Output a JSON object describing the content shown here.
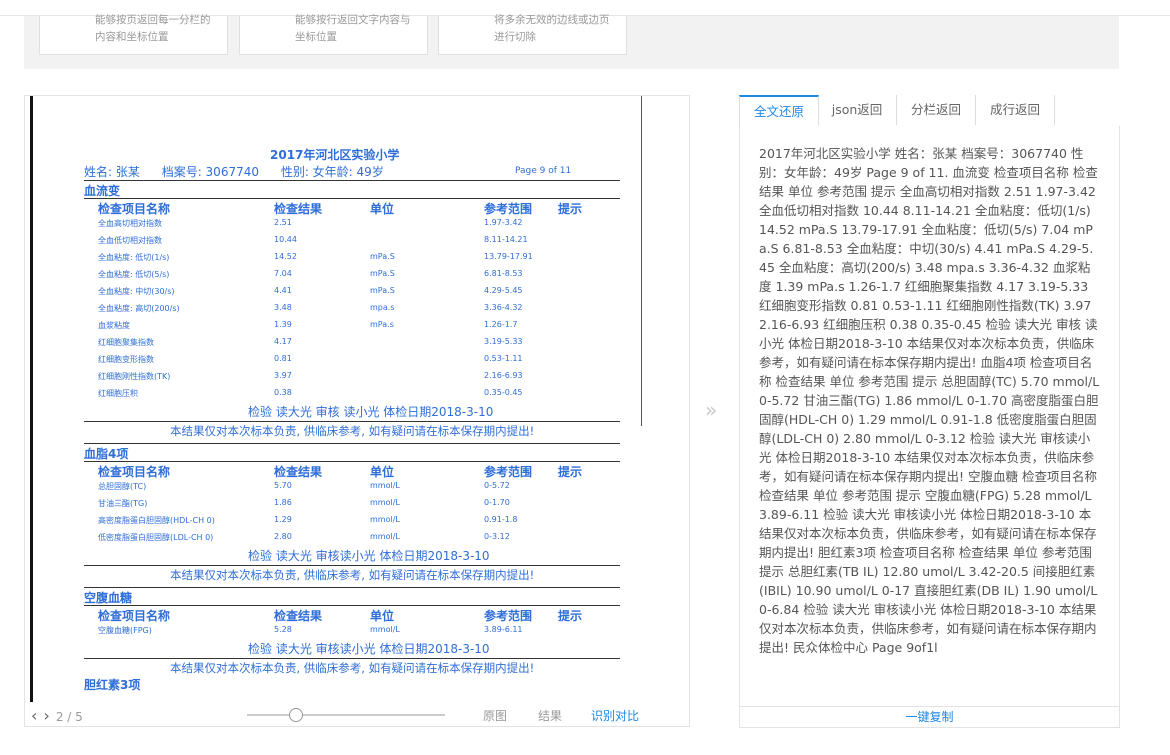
{
  "features": [
    {
      "desc": "能够按页返回每一分栏的\n内容和坐标位置"
    },
    {
      "desc": "能够按行返回文字内容与\n坐标位置"
    },
    {
      "desc": "将多余无效的边线或边页\n进行切除"
    }
  ],
  "doc": {
    "title": "2017年河北区实验小学",
    "name": "姓名: 张某",
    "file_no": "档案号: 3067740",
    "gender": "性别: 女年龄: 49岁",
    "page": "Page 9 of 11",
    "sections": [
      {
        "name": "血流变",
        "headers": [
          "检查项目名称",
          "检查结果",
          "单位",
          "参考范围",
          "提示"
        ],
        "rows": [
          [
            "全血高切相对指数",
            "2.51",
            "",
            "1.97-3.42"
          ],
          [
            "全血低切相对指数",
            "10.44",
            "",
            "8.11-14.21"
          ],
          [
            "全血粘度: 低切(1/s)",
            "14.52",
            "mPa.S",
            "13.79-17.91"
          ],
          [
            "全血粘度: 低切(5/s)",
            "7.04",
            "mPa.S",
            "6.81-8.53"
          ],
          [
            "全血粘度: 中切(30/s)",
            "4.41",
            "mPa.S",
            "4.29-5.45"
          ],
          [
            "全血粘度: 高切(200/s)",
            "3.48",
            "mpa.s",
            "3.36-4.32"
          ],
          [
            "血浆粘度",
            "1.39",
            "mPa.s",
            "1.26-1.7"
          ],
          [
            "红细胞聚集指数",
            "4.17",
            "",
            "3.19-5.33"
          ],
          [
            "红细胞变形指数",
            "0.81",
            "",
            "0.53-1.11"
          ],
          [
            "红细胞刚性指数(TK)",
            "3.97",
            "",
            "2.16-6.93"
          ],
          [
            "红细胞压积",
            "0.38",
            "",
            "0.35-0.45"
          ]
        ],
        "sign": "检验  读大光    审核  读小光    体检日期2018-3-10",
        "note": "本结果仅对本次标本负责, 供临床参考, 如有疑问请在标本保存期内提出!"
      },
      {
        "name": "血脂4项",
        "headers": [
          "检查项目名称",
          "检查结果",
          "单位",
          "参考范围",
          "提示"
        ],
        "rows": [
          [
            "总胆固醇(TC)",
            "5.70",
            "mmol/L",
            "0-5.72"
          ],
          [
            "甘油三酯(TG)",
            "1.86",
            "mmol/L",
            "0-1.70"
          ],
          [
            "高密度脂蛋白胆固醇(HDL-CH 0)",
            "1.29",
            "mmol/L",
            "0.91-1.8"
          ],
          [
            "低密度脂蛋白胆固醇(LDL-CH 0)",
            "2.80",
            "mmol/L",
            "0-3.12"
          ]
        ],
        "sign": "检验  读大光    审核读小光    体检日期2018-3-10",
        "note": "本结果仅对本次标本负责, 供临床参考, 如有疑问请在标本保存期内提出!"
      },
      {
        "name": "空腹血糖",
        "headers": [
          "检查项目名称",
          "检查结果",
          "单位",
          "参考范围",
          "提示"
        ],
        "rows": [
          [
            "空腹血糖(FPG)",
            "5.28",
            "mmol/L",
            "3.89-6.11"
          ]
        ],
        "sign": "检验  读大光    审核读小光    体检日期2018-3-10",
        "note": "本结果仅对本次标本负责, 供临床参考, 如有疑问请在标本保存期内提出!"
      }
    ],
    "next_section": "胆红素3项"
  },
  "viewer": {
    "page_indicator": "2 / 5",
    "btn_original": "原图",
    "btn_result": "结果",
    "btn_compare": "识别对比"
  },
  "tabs": [
    "全文还原",
    "json返回",
    "分栏返回",
    "成行返回"
  ],
  "result_text": "2017年河北区实验小学 姓名：张某 档案号：3067740 性别：女年龄：49岁 Page 9 of 11. 血流变 检查项目名称 检查结果 单位 参考范围 提示 全血高切相对指数 2.51 1.97-3.42 全血低切相对指数 10.44 8.11-14.21 全血粘度：低切(1/s) 14.52 mPa.S 13.79-17.91 全血粘度：低切(5/s) 7.04 mPa.S 6.81-8.53 全血粘度：中切(30/s) 4.41 mPa.S 4.29-5.45 全血粘度：高切(200/s) 3.48 mpa.s 3.36-4.32 血浆粘度 1.39 mPa.s 1.26-1.7 红细胞聚集指数 4.17 3.19-5.33 红细胞变形指数 0.81 0.53-1.11 红细胞刚性指数(TK) 3.97 2.16-6.93 红细胞压积 0.38 0.35-0.45 检验 读大光 审核 读小光 体检日期2018-3-10 本结果仅对本次标本负责，供临床参考，如有疑问请在标本保存期内提出! 血脂4项 检查项目名称 检查结果 单位 参考范围 提示 总胆固醇(TC) 5.70 mmol/L 0-5.72 甘油三酯(TG) 1.86 mmol/L 0-1.70 高密度脂蛋白胆固醇(HDL-CH 0) 1.29 mmol/L 0.91-1.8 低密度脂蛋白胆固醇(LDL-CH 0) 2.80 mmol/L 0-3.12 检验 读大光 审核读小光 体检日期2018-3-10 本结果仅对本次标本负责，供临床参考，如有疑问请在标本保存期内提出! 空腹血糖 检查项目名称 检查结果 单位 参考范围 提示 空腹血糖(FPG) 5.28 mmol/L 3.89-6.11 检验 读大光 审核读小光 体检日期2018-3-10 本结果仅对本次标本负责，供临床参考，如有疑问请在标本保存期内提出! 胆红素3项 检查项目名称 检查结果 单位 参考范围 提示 总胆红素(TB IL) 12.80 umol/L 3.42-20.5 间接胆红素(IBIL) 10.90 umol/L 0-17 直接胆红素(DB IL) 1.90 umol/L 0-6.84 检验 读大光 审核读小光 体检日期2018-3-10 本结果仅对本次标本负责，供临床参考，如有疑问请在标本保存期内提出! 民众体检中心 Page 9of1l",
  "copy_label": "一键复制",
  "colors": {
    "accent": "#1e88e5",
    "doc_blue": "#2f6ed8"
  }
}
